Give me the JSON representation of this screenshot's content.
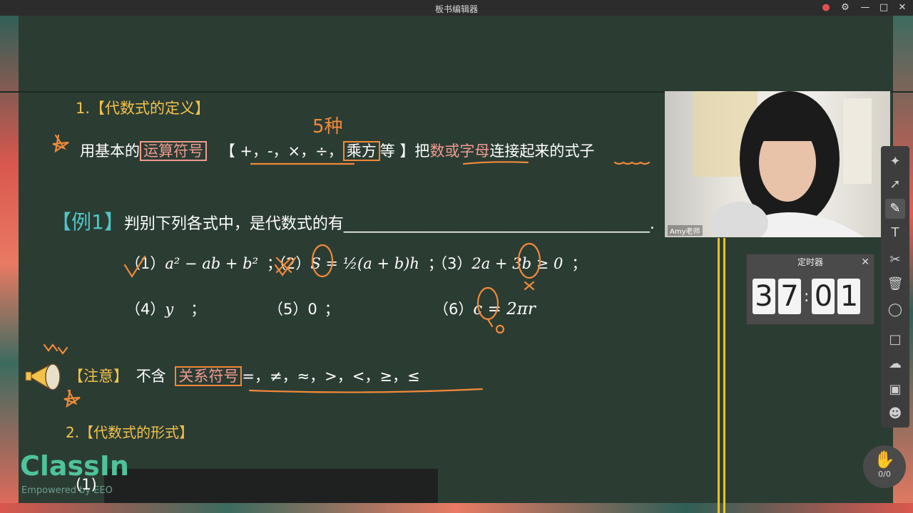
{
  "window": {
    "title": "板书编辑器"
  },
  "section1": {
    "title": "1.【代数式的定义】"
  },
  "definition": {
    "lead": "用基本的",
    "boxed_ops": "运算符号",
    "open_bracket": "【",
    "ops_list": "+，-，×，÷，",
    "boxed_power": "乘方",
    "deng": "等",
    "close_bracket": "】把",
    "pink_phrase": "数或字母",
    "join": "连接起来的",
    "expr": "式子"
  },
  "example": {
    "tag": "【例1】",
    "prompt": "判别下列各式中，是代数式的有_______________________________________.",
    "items": [
      {
        "num": "（1）",
        "expr": "a² − ab + b²",
        "sep": "；"
      },
      {
        "num": "（2）",
        "expr": "S = ½(a + b)h",
        "sep": "；"
      },
      {
        "num": "（3）",
        "expr": "2a + 3b ≥ 0",
        "sep": "；"
      },
      {
        "num": "（4）",
        "expr": "y",
        "sep": "；"
      },
      {
        "num": "（5）",
        "expr": "0",
        "sep": "；"
      },
      {
        "num": "（6）",
        "expr": "c = 2πr",
        "sep": ""
      }
    ]
  },
  "note": {
    "tag": "【注意】",
    "text": "不含",
    "boxed": "关系符号",
    "symbols": "=，≠，≈，>，<，≥，≤"
  },
  "section2": {
    "title": "2.【代数式的形式】"
  },
  "handwriting": {
    "five_kinds": "5种"
  },
  "video": {
    "name": "Amy老师"
  },
  "timer": {
    "title": "定时器",
    "digits": [
      "3",
      "7",
      "0",
      "1"
    ]
  },
  "raise_hand": {
    "count": "0/0"
  },
  "branding": {
    "logo": "ClassIn",
    "subtitle": "Empowered by EEO"
  },
  "caption": {
    "text": "(1)"
  },
  "toolbar": {
    "tools": [
      "cursor-sparkle-icon",
      "select-move-icon",
      "pen-icon",
      "text-icon",
      "scissors-icon",
      "trash-icon",
      "eraser-icon",
      "chat-icon",
      "cloud-icon",
      "toolbox-icon",
      "users-icon"
    ]
  },
  "colors": {
    "board": "#2b3c33",
    "accent": "#f08a3a",
    "yellow": "#f3c24a",
    "pink": "#f09a90",
    "teal": "#4fc6c8"
  }
}
